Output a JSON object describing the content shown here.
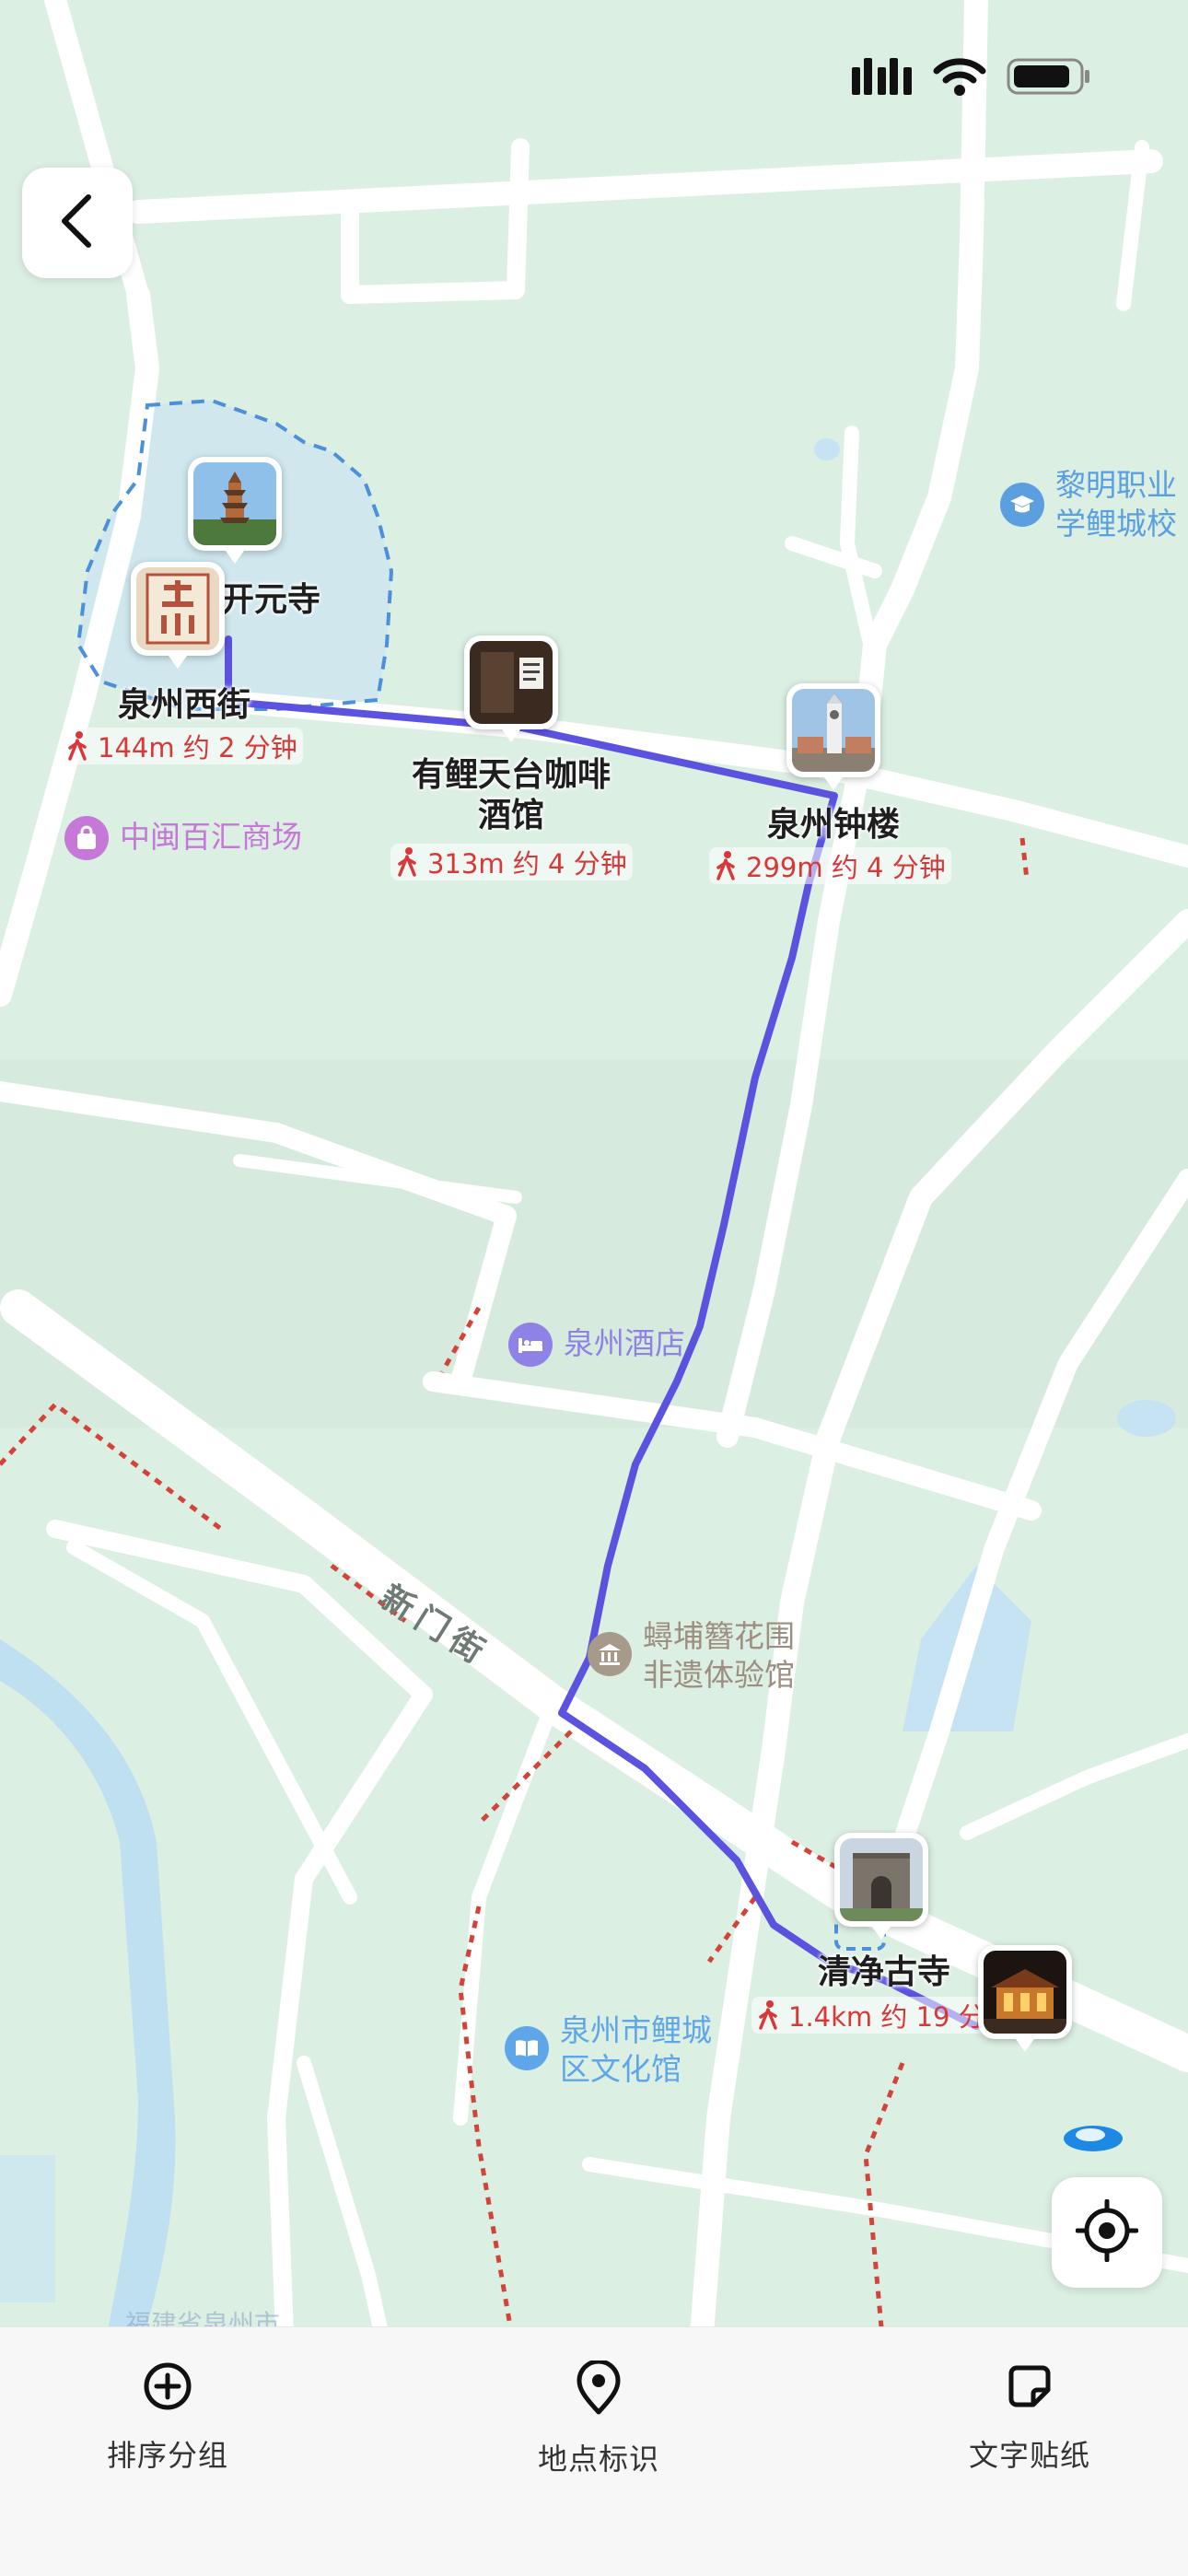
{
  "status_bar": {
    "icons": [
      "cellular-signal-icon",
      "wifi-icon",
      "battery-icon"
    ]
  },
  "nav": {
    "back_icon": "chevron-left-icon",
    "locate_icon": "crosshair-locate-icon"
  },
  "map": {
    "pois": [
      {
        "name": "黎明职业\n学鲤城校",
        "icon": "school-icon",
        "color": "#5b9fe0"
      },
      {
        "name": "中闽百汇商场",
        "icon": "shopping-bag-icon",
        "color": "#c678d8"
      },
      {
        "name": "泉州酒店",
        "icon": "hotel-bed-icon",
        "color": "#8e82e6"
      },
      {
        "name": "蟳埔簪花围\n非遗体验馆",
        "icon": "museum-icon",
        "color": "#a89a8a"
      },
      {
        "name": "泉州市鲤城\n区文化馆",
        "icon": "library-book-icon",
        "color": "#5fa6e8"
      }
    ],
    "street": "新门街",
    "partial_label": "福建省泉州市"
  },
  "route": {
    "color": "#5b53e0",
    "stops": [
      {
        "name": "开元寺",
        "icon": "pagoda-photo"
      },
      {
        "name": "泉州西街",
        "icon": "quanzhou-calligraphy-photo"
      },
      {
        "name": "有鲤天台咖啡\n酒馆",
        "icon": "cafe-photo"
      },
      {
        "name": "泉州钟楼",
        "icon": "clock-tower-photo"
      },
      {
        "name": "清净古寺",
        "icon": "mosque-ruins-photo"
      },
      {
        "name": "",
        "icon": "night-temple-photo"
      }
    ],
    "segments": [
      {
        "text": "144m 约 2 分钟",
        "icon": "walking-person-icon"
      },
      {
        "text": "313m 约 4 分钟",
        "icon": "walking-person-icon"
      },
      {
        "text": "299m 约 4 分钟",
        "icon": "walking-person-icon"
      },
      {
        "text": "1.4km 约 19 分",
        "icon": "walking-person-icon"
      }
    ],
    "segment_color": "#d8383a"
  },
  "toolbar": {
    "items": [
      {
        "label": "排序分组",
        "icon": "plus-circle-icon"
      },
      {
        "label": "地点标识",
        "icon": "map-pin-icon"
      },
      {
        "label": "文字贴纸",
        "icon": "sticker-note-icon"
      }
    ]
  }
}
